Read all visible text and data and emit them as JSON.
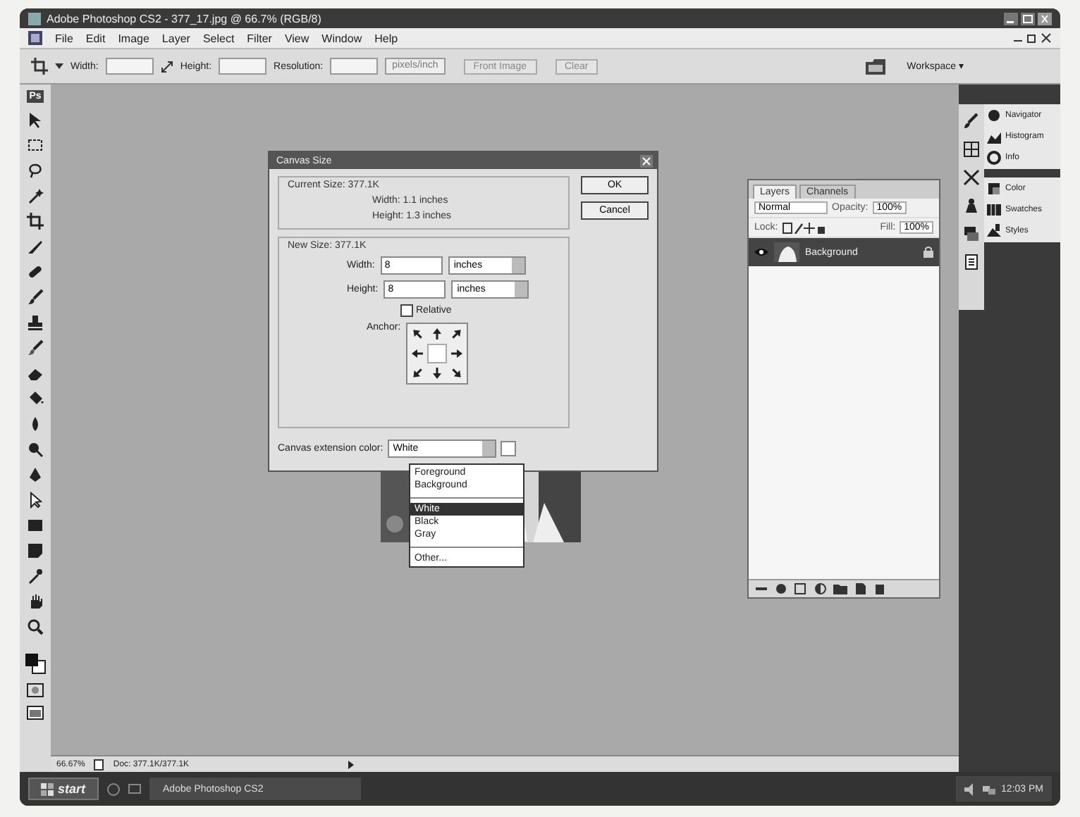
{
  "window": {
    "title": "Adobe Photoshop CS2 - 377_17.jpg @ 66.7% (RGB/8)"
  },
  "menu": [
    "File",
    "Edit",
    "Image",
    "Layer",
    "Select",
    "Filter",
    "View",
    "Window",
    "Help"
  ],
  "options_bar": {
    "width_label": "Width:",
    "height_label": "Height:",
    "resolution_label": "Resolution:",
    "resolution_unit": "pixels/inch",
    "buttons": [
      "Front Image",
      "Clear"
    ],
    "workspace": "Workspace ▾"
  },
  "toolbox": {
    "logo": "Ps"
  },
  "dialog": {
    "title": "Canvas Size",
    "current_legend": "Current Size: 377.1K",
    "current_width": "Width:  1.1 inches",
    "current_height": "Height:  1.3 inches",
    "new_legend": "New Size: 377.1K",
    "fields": [
      {
        "label": "Width:",
        "value": "8",
        "unit": "inches"
      },
      {
        "label": "Height:",
        "value": "8",
        "unit": "inches"
      }
    ],
    "relative": {
      "label": "Relative",
      "checked": false
    },
    "anchor_label": "Anchor:",
    "buttons": [
      "OK",
      "Cancel"
    ],
    "extension_label": "Canvas extension color:",
    "extension_value": "White"
  },
  "dropdown": {
    "items": [
      {
        "kind": "item",
        "label": "Foreground",
        "selected": false
      },
      {
        "kind": "item",
        "label": "Background",
        "selected": false
      },
      {
        "kind": "separator"
      },
      {
        "kind": "item",
        "label": "White",
        "selected": true
      },
      {
        "kind": "item",
        "label": "Black",
        "selected": false
      },
      {
        "kind": "item",
        "label": "Gray",
        "selected": false
      },
      {
        "kind": "separator"
      },
      {
        "kind": "item",
        "label": "Other...",
        "selected": false
      }
    ]
  },
  "layers_panel": {
    "tabs": [
      {
        "label": "Layers",
        "selected": true
      },
      {
        "label": "Channels",
        "selected": false
      }
    ],
    "blend_mode": "Normal",
    "opacity_label": "Opacity:",
    "opacity": "100%",
    "lock_label": "Lock:",
    "fill_label": "Fill:",
    "fill": "100%",
    "layers": [
      {
        "name": "Background",
        "selected": true,
        "visible": true
      }
    ]
  },
  "dock": {
    "groups": [
      {
        "items": [
          "Navigator",
          "Histogram",
          "Info"
        ]
      },
      {
        "items": [
          "Color",
          "Swatches",
          "Styles"
        ]
      }
    ]
  },
  "status_bar": {
    "zoom": "66.67%",
    "doc": "Doc: 377.1K/377.1K"
  },
  "taskbar": {
    "start": "start",
    "tasks": [
      {
        "label": "Adobe Photoshop CS2",
        "selected": true
      }
    ],
    "clock": "12:03 PM"
  }
}
